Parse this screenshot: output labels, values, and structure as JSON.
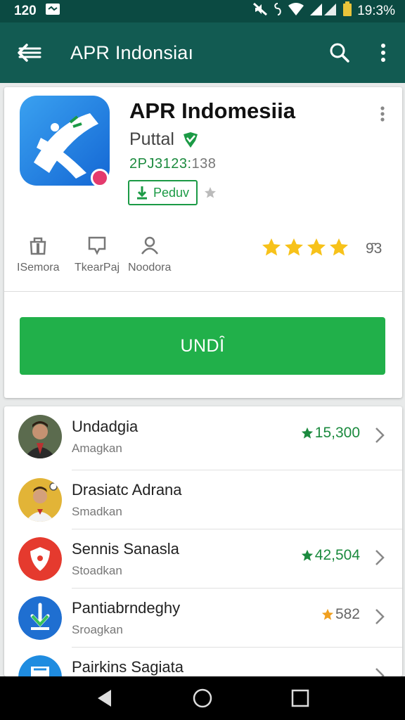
{
  "status_bar": {
    "time": "120",
    "clock": "19:3%",
    "icons": [
      "notification-icon",
      "mute-icon",
      "vibrate-icon",
      "wifi-icon",
      "signal-icon",
      "battery-icon"
    ]
  },
  "app_bar": {
    "title": "APR Indonsiaı",
    "icons": [
      "back-arrow-icon",
      "search-icon",
      "more-vert-icon"
    ]
  },
  "app": {
    "title": "APR Indomesiia",
    "developer": "Puttal",
    "id_highlight": "2PJ3123:",
    "id_rest": "138",
    "product_badge": "Peduv",
    "meta": [
      {
        "label": "ISemora",
        "icon": "bag-icon"
      },
      {
        "label": "TkearPaj",
        "icon": "chat-icon"
      },
      {
        "label": "Noodora",
        "icon": "person-icon"
      }
    ],
    "rating": 4.5,
    "rating_count": "9̄3",
    "install_label": "UNDȊ"
  },
  "list": {
    "items": [
      {
        "title": "Undadgia",
        "subtitle": "Amagkan",
        "score": "15,300",
        "star_color": "#1b8a3e",
        "avatar": "person-avatar-1",
        "chevron": true
      },
      {
        "title": "Drasiatc Adrana",
        "subtitle": "Smadkan",
        "score": "",
        "star_color": "",
        "avatar": "person-avatar-2",
        "chevron": false
      },
      {
        "title": "Sennis Sanasla",
        "subtitle": "Stoadkan",
        "score": "42,504",
        "star_color": "#1b8a3e",
        "avatar": "shield-app-icon",
        "chevron": true
      },
      {
        "title": "Pantiabrndeghy",
        "subtitle": "Sroagkan",
        "score": "582",
        "star_color": "#f0a020",
        "avatar": "download-app-icon",
        "chevron": true
      },
      {
        "title": "Pairkins Sagiata",
        "subtitle": "",
        "score": "",
        "star_color": "",
        "avatar": "calendar-app-icon",
        "chevron": true
      }
    ]
  },
  "colors": {
    "status_bar": "#0b4a42",
    "app_bar": "#125b52",
    "install_button": "#21b04a",
    "accent_green": "#1b8a3e",
    "star_gold": "#f7c21a"
  }
}
